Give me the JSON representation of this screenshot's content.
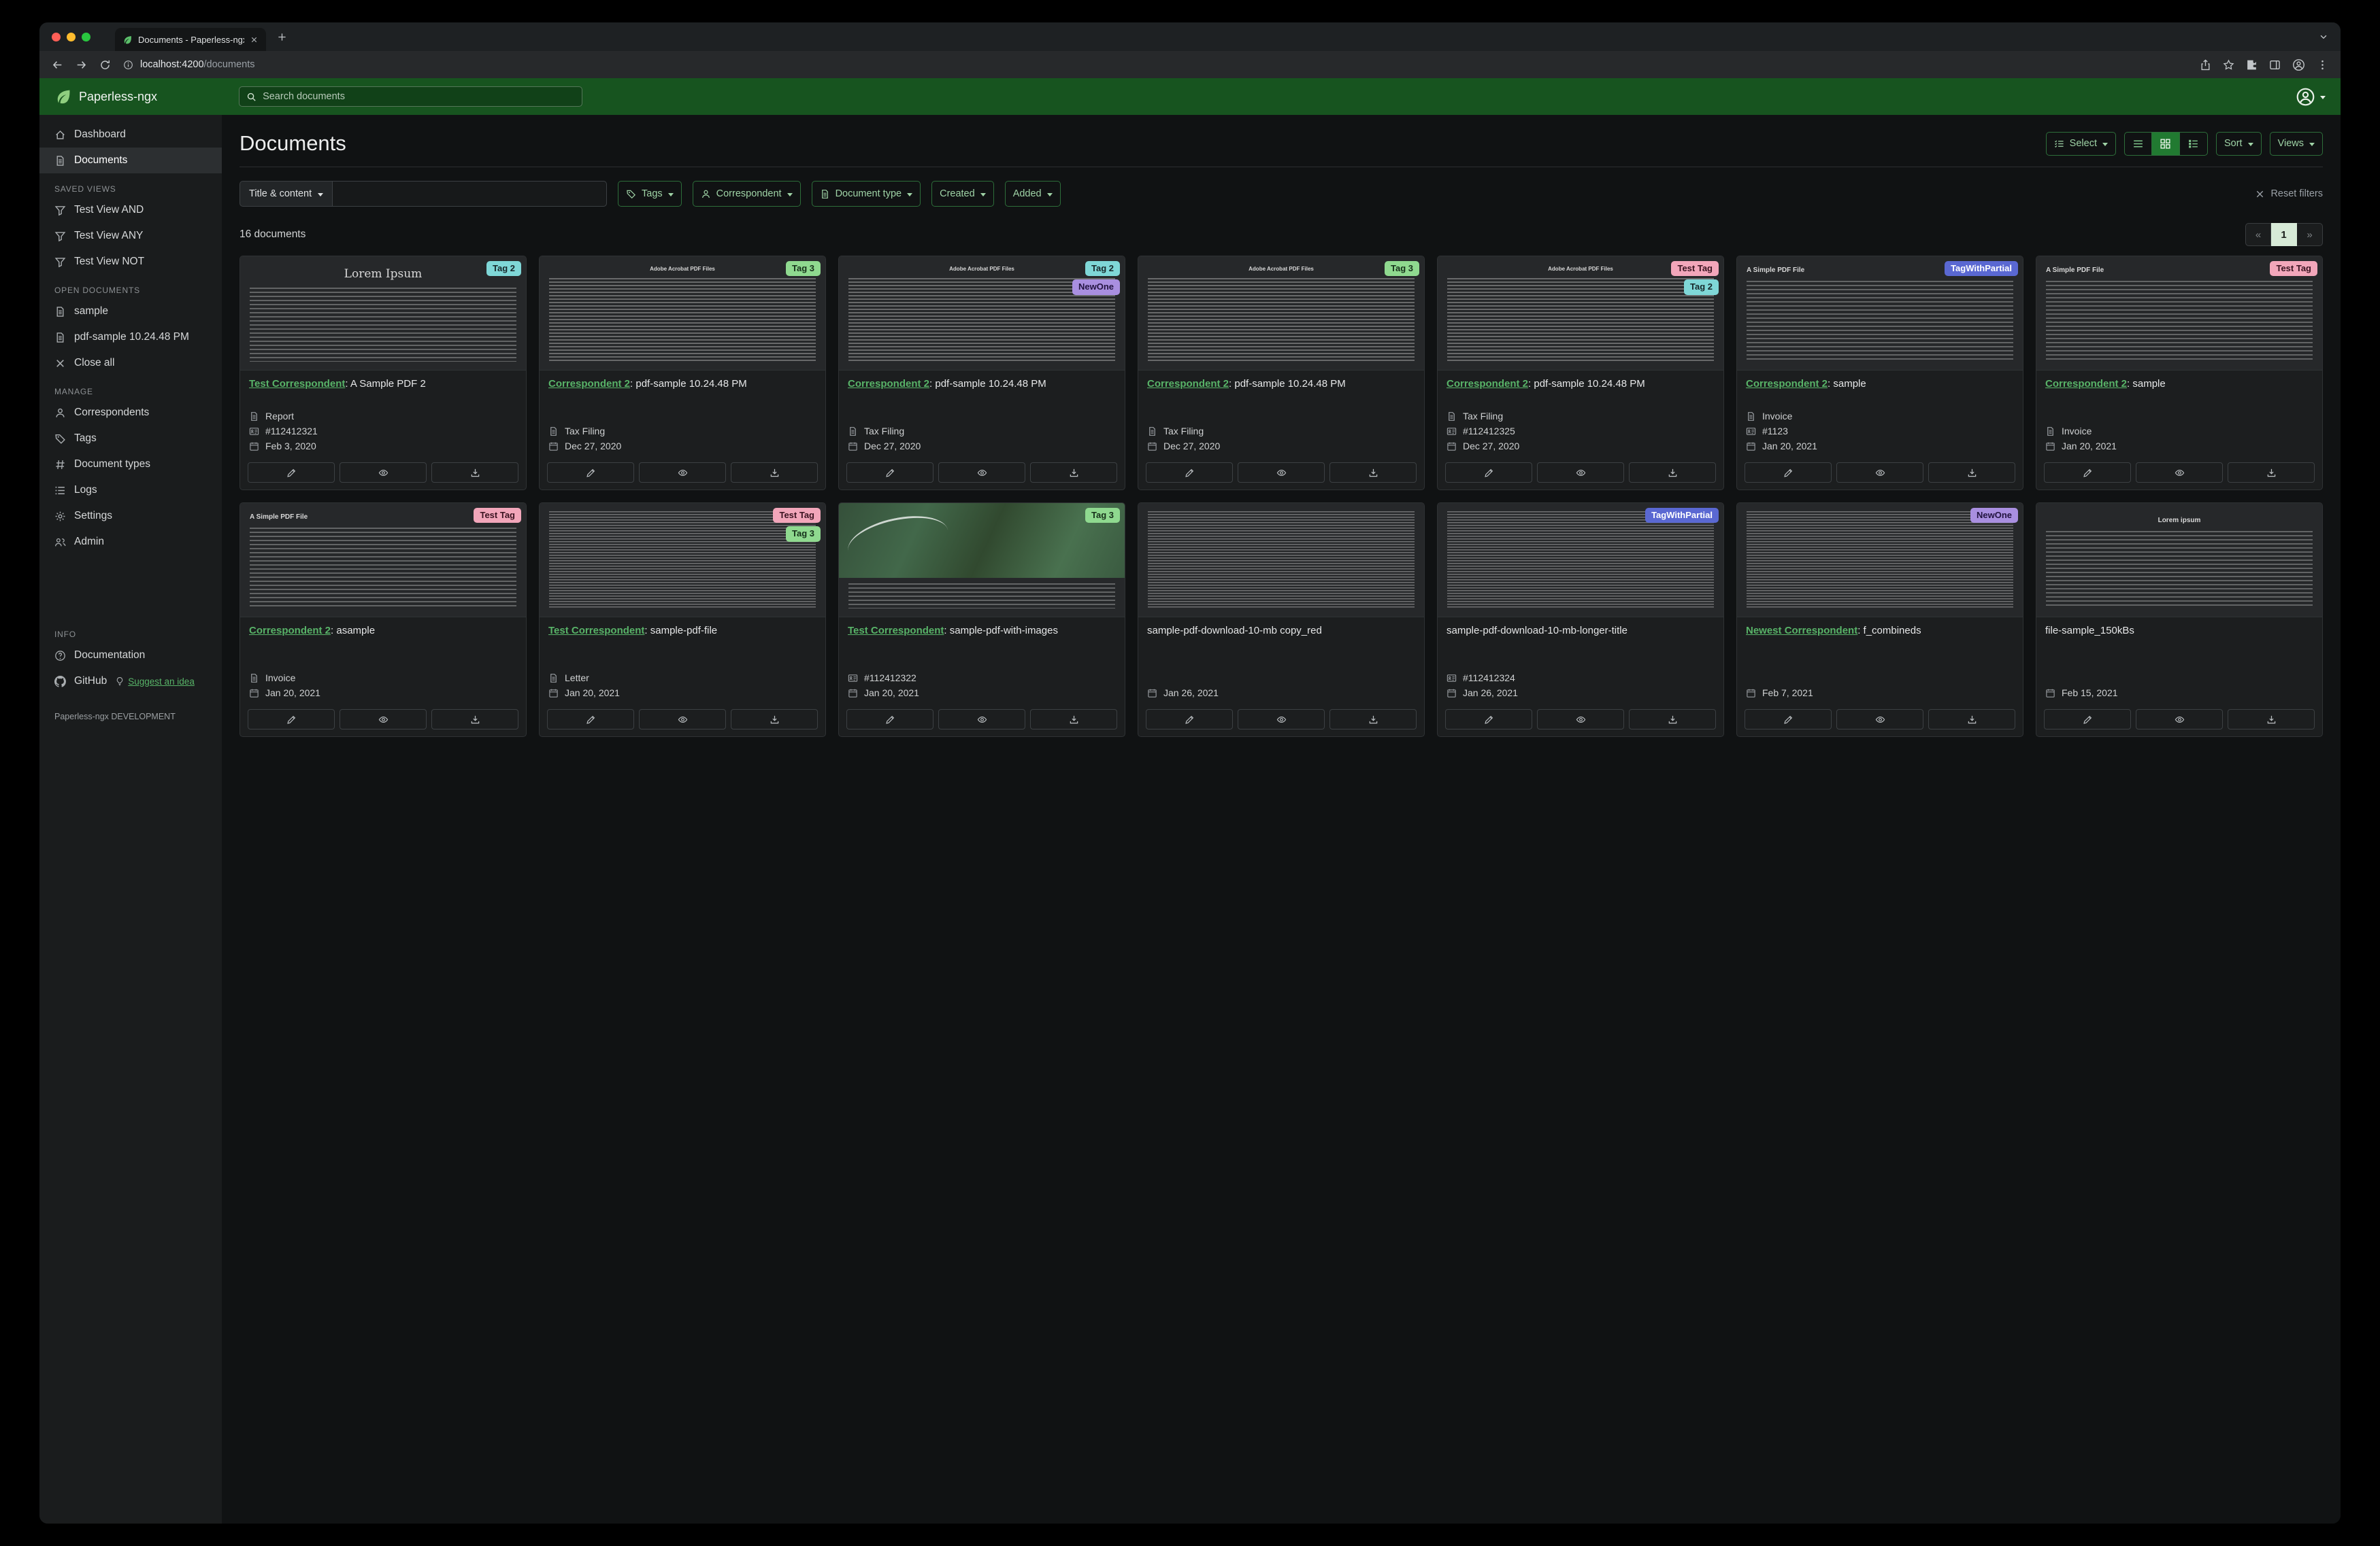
{
  "colors": {
    "brand_green": "#17541f",
    "link_green": "#58b368",
    "accent_border_green": "#2d6e3a",
    "accent_text_green": "#9fd3a6",
    "page_bg": "#101213",
    "sidebar_bg": "#1a1c1d",
    "card_bg": "#1c1e1f"
  },
  "tag_colors": {
    "Tag 2": {
      "bg": "#7fd7d7",
      "fg": "#17272a"
    },
    "Tag 3": {
      "bg": "#8fd98f",
      "fg": "#16301a"
    },
    "NewOne": {
      "bg": "#a98fe0",
      "fg": "#221440"
    },
    "Test Tag": {
      "bg": "#f2a6ba",
      "fg": "#3a1320"
    },
    "TagWithPartial": {
      "bg": "#5a68d2",
      "fg": "#ffffff"
    }
  },
  "browser": {
    "tab_title": "Documents - Paperless-ngx",
    "url_host": "localhost:4200",
    "url_path": "/documents"
  },
  "header": {
    "app_name": "Paperless-ngx",
    "search_placeholder": "Search documents"
  },
  "sidebar": {
    "dashboard": "Dashboard",
    "documents": "Documents",
    "saved_views_label": "SAVED VIEWS",
    "saved_views": [
      "Test View AND",
      "Test View ANY",
      "Test View NOT"
    ],
    "open_documents_label": "OPEN DOCUMENTS",
    "open_documents": [
      "sample",
      "pdf-sample 10.24.48 PM"
    ],
    "close_all": "Close all",
    "manage_label": "MANAGE",
    "manage": [
      "Correspondents",
      "Tags",
      "Document types",
      "Logs",
      "Settings",
      "Admin"
    ],
    "info_label": "INFO",
    "documentation": "Documentation",
    "github": "GitHub",
    "suggest": "Suggest an idea",
    "footer": "Paperless-ngx DEVELOPMENT"
  },
  "main": {
    "title": "Documents",
    "toolbar": {
      "select": "Select",
      "sort": "Sort",
      "views": "Views"
    },
    "filters": {
      "title_content": "Title & content",
      "tags": "Tags",
      "correspondent": "Correspondent",
      "document_type": "Document type",
      "created": "Created",
      "added": "Added",
      "reset": "Reset filters"
    },
    "count": "16 documents",
    "pagination": {
      "prev": "«",
      "page": "1",
      "next": "»"
    },
    "cards": [
      {
        "tags": [
          "Tag 2"
        ],
        "link": "Test Correspondent",
        "title": ": A Sample PDF 2",
        "type": "Report",
        "asn": "#112412321",
        "date": "Feb 3, 2020",
        "thumb": {
          "kind": "lorem",
          "title": "Lorem Ipsum"
        }
      },
      {
        "tags": [
          "Tag 3"
        ],
        "link": "Correspondent 2",
        "title": ": pdf-sample 10.24.48 PM",
        "type": "Tax Filing",
        "asn": null,
        "date": "Dec 27, 2020",
        "thumb": {
          "kind": "acrobat",
          "title": "Adobe Acrobat PDF Files"
        }
      },
      {
        "tags": [
          "Tag 2",
          "NewOne"
        ],
        "link": "Correspondent 2",
        "title": ": pdf-sample 10.24.48 PM",
        "type": "Tax Filing",
        "asn": null,
        "date": "Dec 27, 2020",
        "thumb": {
          "kind": "acrobat",
          "title": "Adobe Acrobat PDF Files"
        }
      },
      {
        "tags": [
          "Tag 3"
        ],
        "link": "Correspondent 2",
        "title": ": pdf-sample 10.24.48 PM",
        "type": "Tax Filing",
        "asn": null,
        "date": "Dec 27, 2020",
        "thumb": {
          "kind": "acrobat",
          "title": "Adobe Acrobat PDF Files"
        }
      },
      {
        "tags": [
          "Test Tag",
          "Tag 2"
        ],
        "link": "Correspondent 2",
        "title": ": pdf-sample 10.24.48 PM",
        "type": "Tax Filing",
        "asn": "#112412325",
        "date": "Dec 27, 2020",
        "thumb": {
          "kind": "acrobat",
          "title": "Adobe Acrobat PDF Files"
        }
      },
      {
        "tags": [
          "TagWithPartial"
        ],
        "link": "Correspondent 2",
        "title": ": sample",
        "type": "Invoice",
        "asn": "#1123",
        "date": "Jan 20, 2021",
        "thumb": {
          "kind": "simple",
          "title": "A Simple PDF File"
        }
      },
      {
        "tags": [
          "Test Tag"
        ],
        "link": "Correspondent 2",
        "title": ": sample",
        "type": "Invoice",
        "asn": null,
        "date": "Jan 20, 2021",
        "thumb": {
          "kind": "simple",
          "title": "A Simple PDF File"
        }
      },
      {
        "tags": [
          "Test Tag"
        ],
        "link": "Correspondent 2",
        "title": ": asample",
        "type": "Invoice",
        "asn": null,
        "date": "Jan 20, 2021",
        "thumb": {
          "kind": "simple",
          "title": "A Simple PDF File"
        }
      },
      {
        "tags": [
          "Test Tag",
          "Tag 3"
        ],
        "link": "Test Correspondent",
        "title": ": sample-pdf-file",
        "type": "Letter",
        "asn": null,
        "date": "Jan 20, 2021",
        "thumb": {
          "kind": "dense",
          "title": ""
        }
      },
      {
        "tags": [
          "Tag 3"
        ],
        "link": "Test Correspondent",
        "title": ": sample-pdf-with-images",
        "type": null,
        "asn": "#112412322",
        "date": "Jan 20, 2021",
        "thumb": {
          "kind": "map",
          "title": ""
        }
      },
      {
        "tags": [],
        "link": null,
        "title": "sample-pdf-download-10-mb copy_red",
        "type": null,
        "asn": null,
        "date": "Jan 26, 2021",
        "thumb": {
          "kind": "dense",
          "title": ""
        }
      },
      {
        "tags": [
          "TagWithPartial"
        ],
        "link": null,
        "title": "sample-pdf-download-10-mb-longer-title",
        "type": null,
        "asn": "#112412324",
        "date": "Jan 26, 2021",
        "thumb": {
          "kind": "dense",
          "title": ""
        }
      },
      {
        "tags": [
          "NewOne"
        ],
        "link": "Newest Correspondent",
        "title": ": f_combineds",
        "type": null,
        "asn": null,
        "date": "Feb 7, 2021",
        "thumb": {
          "kind": "dense",
          "title": ""
        }
      },
      {
        "tags": [],
        "link": null,
        "title": "file-sample_150kBs",
        "type": null,
        "asn": null,
        "date": "Feb 15, 2021",
        "thumb": {
          "kind": "loremcenter",
          "title": "Lorem ipsum"
        }
      }
    ]
  }
}
